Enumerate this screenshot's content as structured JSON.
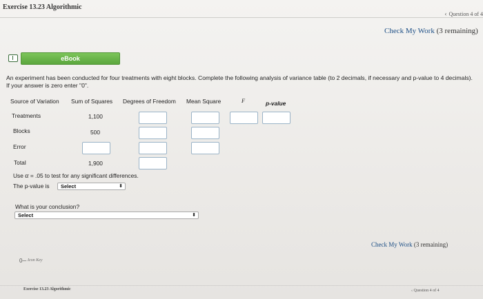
{
  "header": {
    "title": "Exercise 13.23 Algorithmic",
    "question_nav": "Question 4 of 4",
    "check_my_work": "Check My Work",
    "remaining": "(3 remaining)"
  },
  "ebook": {
    "label": "eBook"
  },
  "instructions": "An experiment has been conducted for four treatments with eight blocks. Complete the following analysis of variance table (to 2 decimals, if necessary and p-value to 4 decimals). If your answer is zero enter \"0\".",
  "table": {
    "headers": {
      "source": "Source of Variation",
      "ss": "Sum of Squares",
      "df": "Degrees of Freedom",
      "ms": "Mean Square",
      "f": "F",
      "p": "p-value"
    },
    "rows": [
      {
        "source": "Treatments",
        "ss": "1,100"
      },
      {
        "source": "Blocks",
        "ss": "500"
      },
      {
        "source": "Error",
        "ss": ""
      },
      {
        "source": "Total",
        "ss": "1,900"
      }
    ]
  },
  "alpha_text": {
    "prefix": "Use",
    "symbol": "α",
    "rest": "= .05 to test for any significant differences."
  },
  "pvalue_question": {
    "label": "The p-value is",
    "select_value": "Select"
  },
  "conclusion": {
    "label": "What is your conclusion?",
    "select_value": "Select"
  },
  "footer": {
    "check_my_work": "Check My Work",
    "remaining": "(3 remaining)",
    "icon_key": "Icon Key",
    "title": "Exercise 13.23 Algorithmic",
    "question_nav": "Question 4 of 4"
  }
}
